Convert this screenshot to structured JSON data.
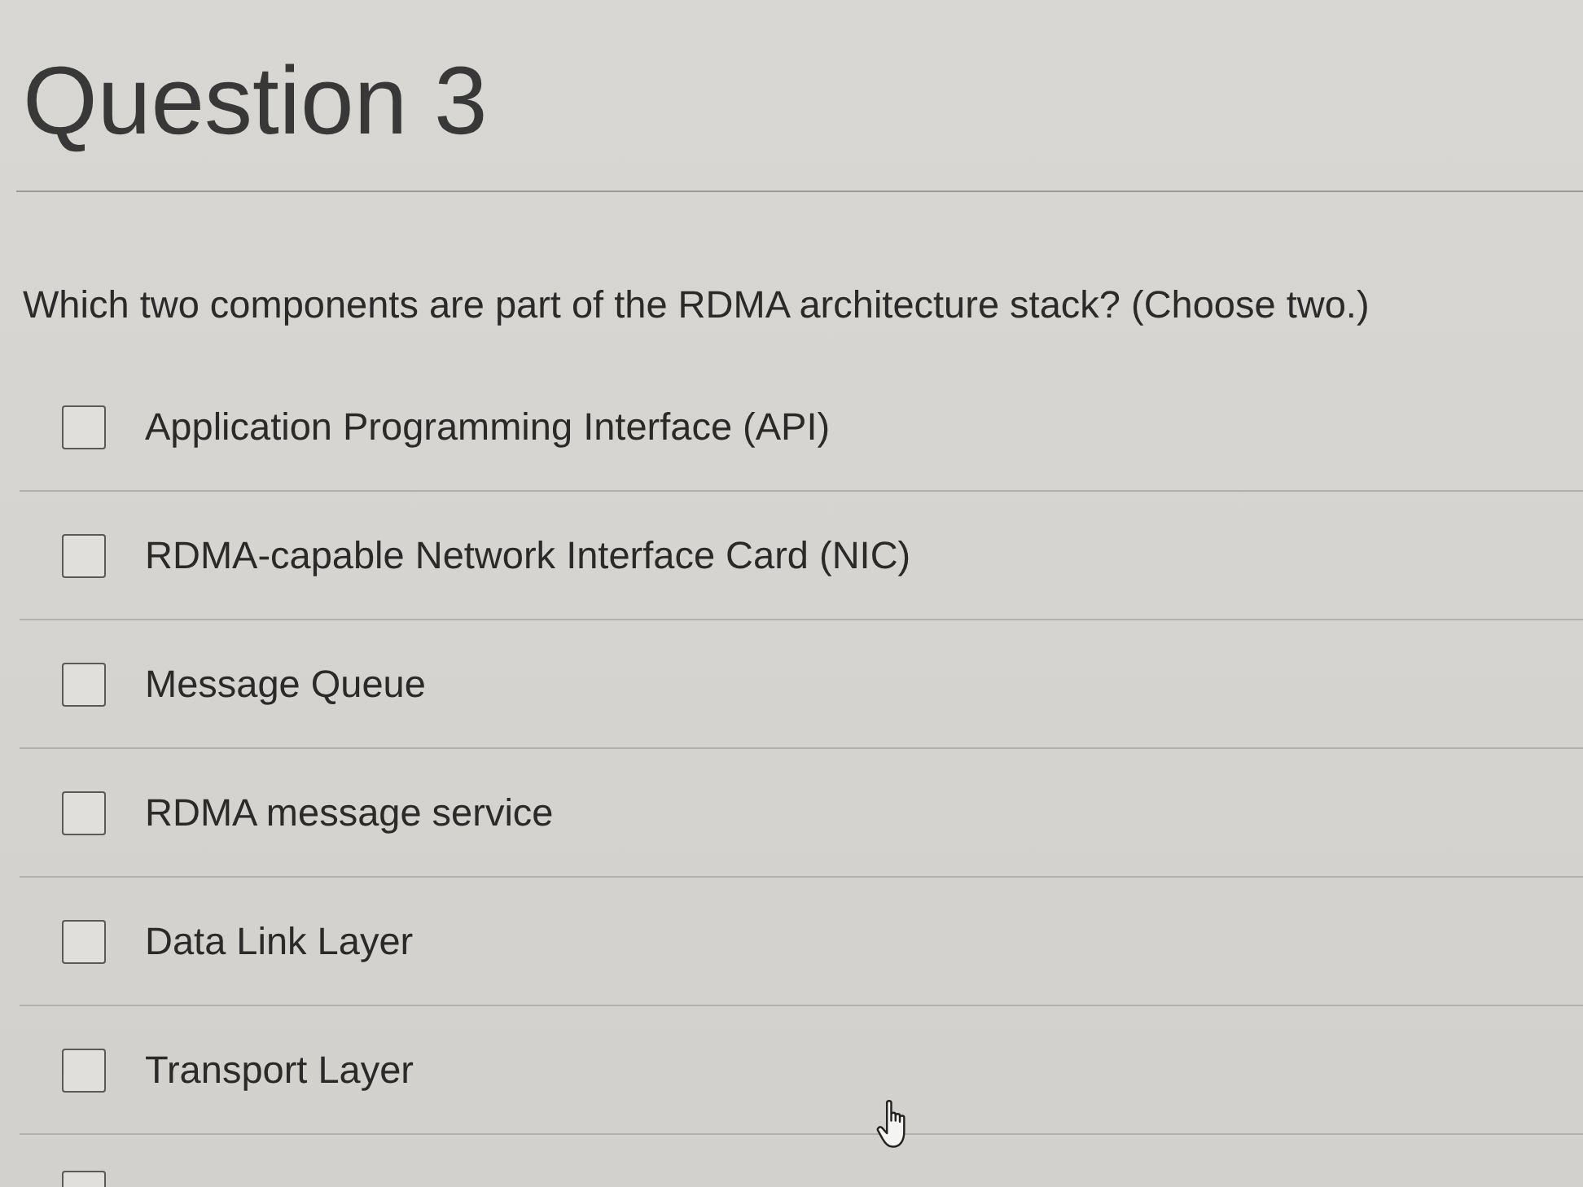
{
  "page": {
    "title": "Question 3"
  },
  "question": {
    "text": "Which two components are part of the RDMA architecture stack? (Choose two.)"
  },
  "options": [
    {
      "label": "Application Programming Interface (API)",
      "checked": false
    },
    {
      "label": "RDMA-capable Network Interface Card (NIC)",
      "checked": false
    },
    {
      "label": "Message Queue",
      "checked": false
    },
    {
      "label": "RDMA message service",
      "checked": false
    },
    {
      "label": "Data Link Layer",
      "checked": false
    },
    {
      "label": "Transport Layer",
      "checked": false
    },
    {
      "checked": false
    }
  ]
}
